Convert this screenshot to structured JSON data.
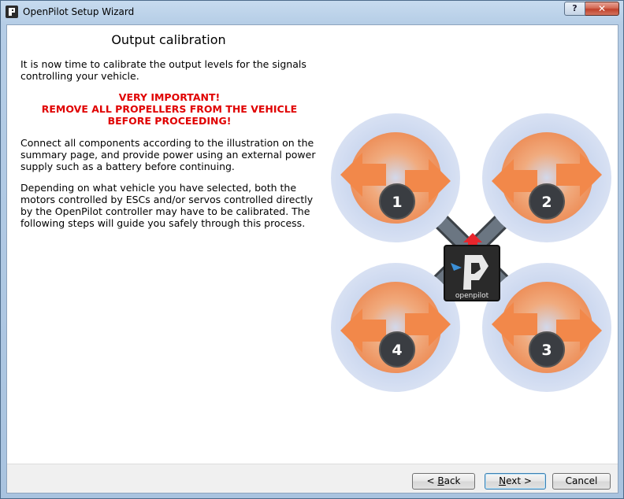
{
  "window": {
    "title": "OpenPilot Setup Wizard",
    "help_label": "?",
    "close_label": "✕"
  },
  "page": {
    "title": "Output calibration",
    "intro": "It is now time to calibrate the output levels for the signals controlling your vehicle.",
    "warning_line1": "VERY IMPORTANT!",
    "warning_line2": "REMOVE ALL PROPELLERS FROM THE VEHICLE",
    "warning_line3": "BEFORE PROCEEDING!",
    "connect_text": "Connect all components according to the illustration on the summary page, and provide power using an external power supply such as a battery before continuing.",
    "depending_text": "Depending on what vehicle you have selected, both the motors controlled by ESCs and/or servos controlled directly by the OpenPilot controller may have to be calibrated. The following steps will guide you safely through this process."
  },
  "illustration": {
    "motor_labels": [
      "1",
      "2",
      "3",
      "4"
    ],
    "logo_text": "openpilot",
    "colors": {
      "disc_outer": "#d6e0f2",
      "disc_inner": "#c3d1ec",
      "arrow": "#f2884a",
      "body": "#2a2a2a",
      "arm": "#5f6975",
      "motor": "#3a3d42",
      "forward_arrow": "#e8262d",
      "logo_blue": "#3b8fd6"
    }
  },
  "buttons": {
    "back": {
      "prefix": "< ",
      "mnemonic": "B",
      "rest": "ack"
    },
    "next": {
      "mnemonic": "N",
      "rest": "ext >"
    },
    "cancel": "Cancel"
  }
}
